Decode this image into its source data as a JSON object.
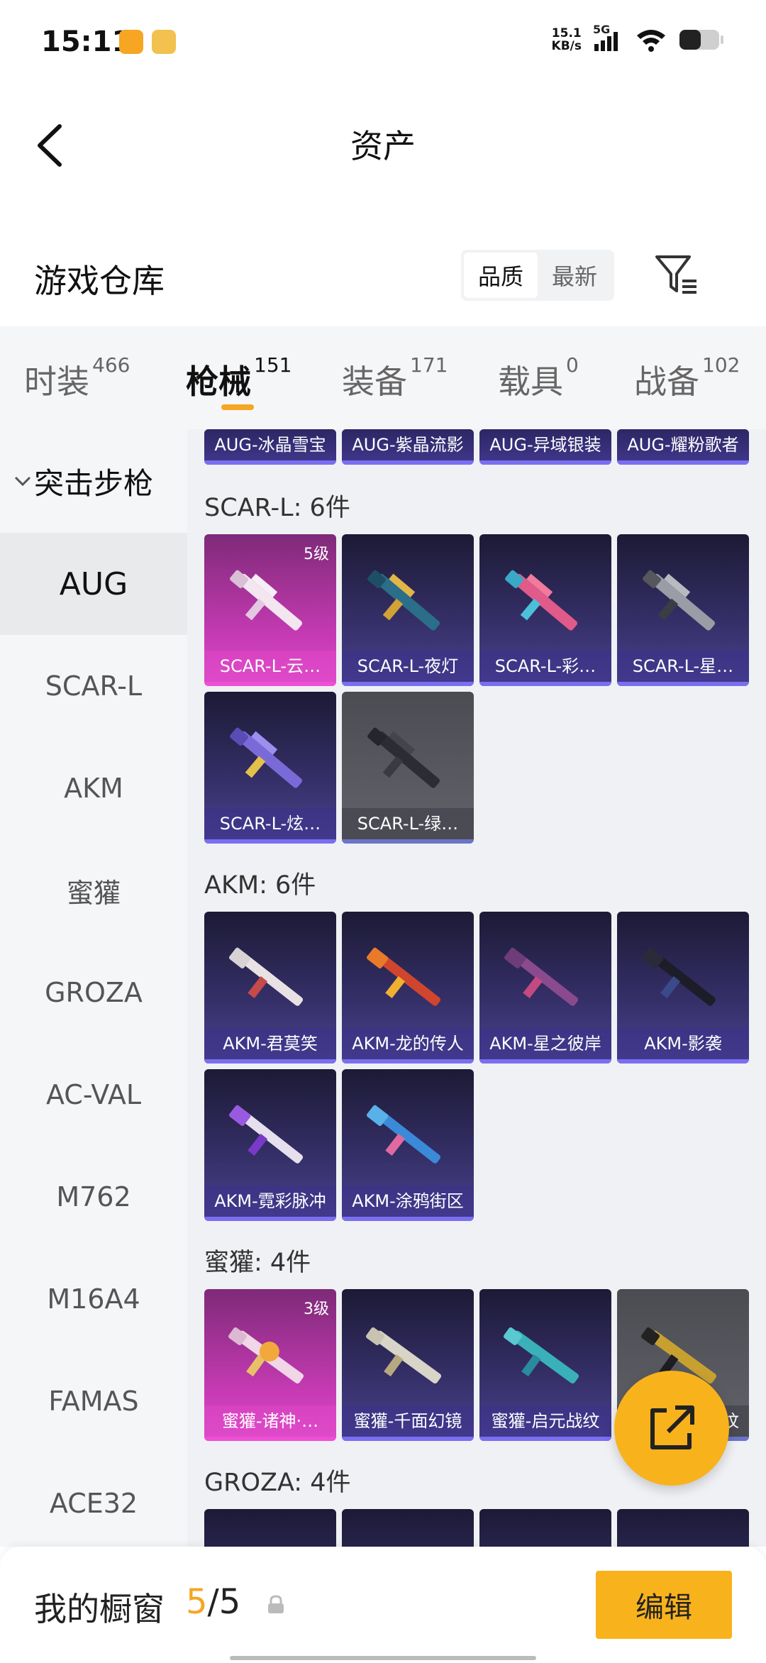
{
  "status_bar": {
    "time": "15:11",
    "net_speed_value": "15.1",
    "net_speed_unit": "KB/s",
    "network": "5G"
  },
  "header": {
    "title": "资产",
    "back_icon": "chevron-left-icon"
  },
  "warehouse": {
    "title": "游戏仓库",
    "sort_options": [
      "品质",
      "最新"
    ],
    "selected_sort": "品质",
    "filter_icon": "filter-icon"
  },
  "tabs": [
    {
      "label": "时装",
      "count": "466"
    },
    {
      "label": "枪械",
      "count": "151",
      "active": true
    },
    {
      "label": "装备",
      "count": "171"
    },
    {
      "label": "载具",
      "count": "0"
    },
    {
      "label": "战备",
      "count": "102"
    }
  ],
  "sidebar": {
    "group": "突击步枪",
    "items": [
      "AUG",
      "SCAR-L",
      "AKM",
      "蜜獾",
      "GROZA",
      "AC-VAL",
      "M762",
      "M16A4",
      "FAMAS",
      "ACE32"
    ],
    "active": "AUG"
  },
  "sections": {
    "aug_partial": [
      "AUG-冰晶雪宝",
      "AUG-紫晶流影",
      "AUG-异域银装",
      "AUG-耀粉歌者"
    ],
    "scar": {
      "title": "SCAR-L: 6件",
      "items": [
        {
          "name": "SCAR-L-云…",
          "level": "5级"
        },
        {
          "name": "SCAR-L-夜灯"
        },
        {
          "name": "SCAR-L-彩…"
        },
        {
          "name": "SCAR-L-星…"
        },
        {
          "name": "SCAR-L-炫…"
        },
        {
          "name": "SCAR-L-绿…"
        }
      ]
    },
    "akm": {
      "title": "AKM: 6件",
      "items": [
        {
          "name": "AKM-君莫笑"
        },
        {
          "name": "AKM-龙的传人"
        },
        {
          "name": "AKM-星之彼岸"
        },
        {
          "name": "AKM-影袭"
        },
        {
          "name": "AKM-霓彩脉冲"
        },
        {
          "name": "AKM-涂鸦街区"
        }
      ]
    },
    "mihuan": {
      "title": "蜜獾: 4件",
      "items": [
        {
          "name": "蜜獾-诸神·…",
          "level": "3级"
        },
        {
          "name": "蜜獾-千面幻镜"
        },
        {
          "name": "蜜獾-启元战纹"
        },
        {
          "name": "纹"
        }
      ]
    },
    "groza": {
      "title": "GROZA: 4件"
    }
  },
  "bottom_bar": {
    "label": "我的橱窗",
    "current": "5",
    "separator": "/",
    "total": "5",
    "edit_label": "编辑"
  },
  "colors": {
    "accent": "#f8b21c",
    "card_purple": "#36306a",
    "card_pink": "#c93bb6"
  }
}
